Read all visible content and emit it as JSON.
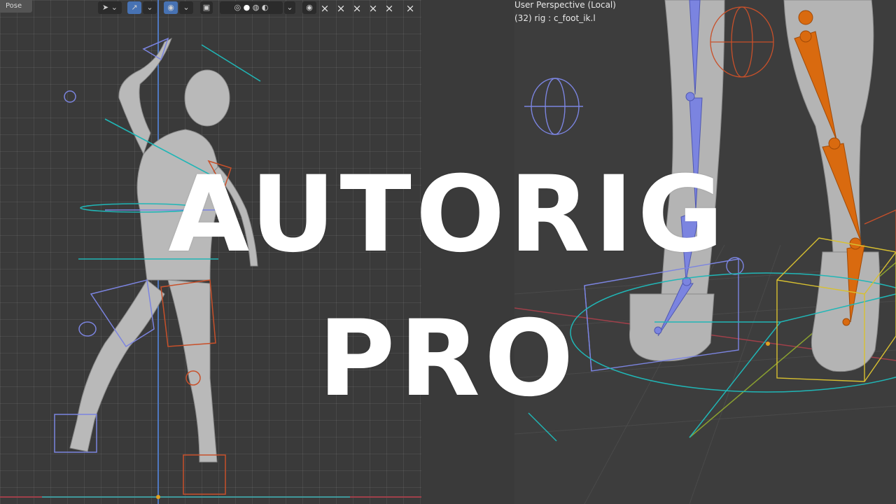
{
  "toolbar": {
    "mode": "Pose",
    "close_icons": [
      "×",
      "×",
      "×",
      "×",
      "×",
      "×"
    ]
  },
  "viewport_right": {
    "view_name": "User Perspective (Local)",
    "active_object": "(32) rig : c_foot_ik.l"
  },
  "title": {
    "line1": "AUTORIG",
    "line2": "PRO"
  },
  "colors": {
    "bone_blue": "#7b84e0",
    "bone_orange": "#d96a0f",
    "widget_cyan": "#20b6b6",
    "widget_yellow": "#d8c030",
    "widget_red": "#c8502a"
  }
}
